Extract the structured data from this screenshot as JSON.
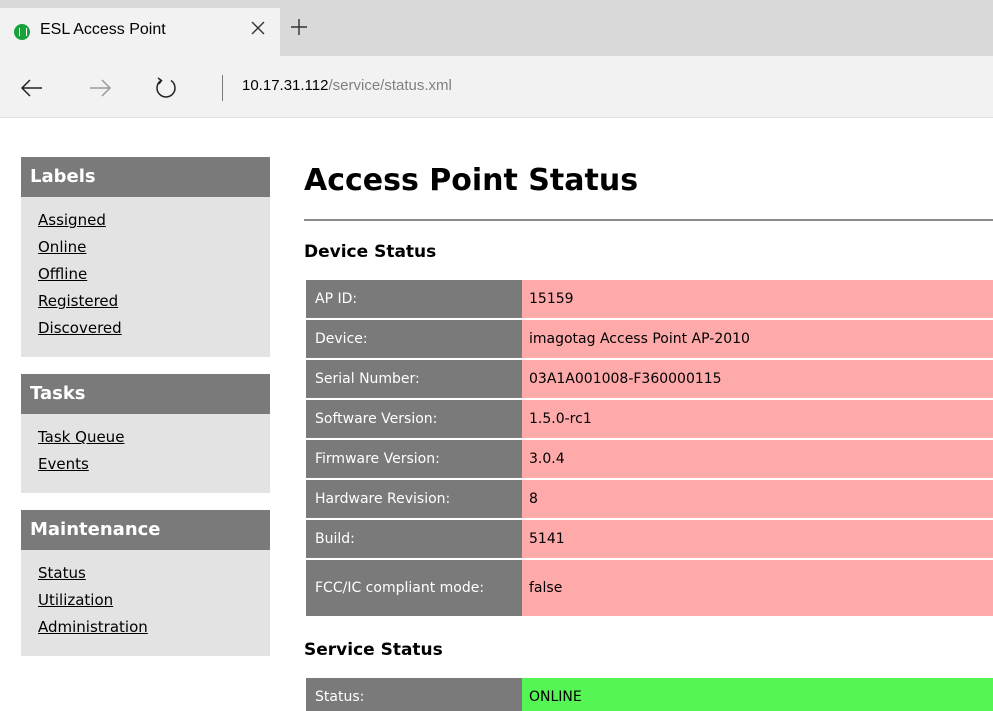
{
  "browser": {
    "tab_title": "ESL Access Point",
    "url_host": "10.17.31.112",
    "url_path": "/service/status.xml"
  },
  "sidebar": {
    "sections": [
      {
        "title": "Labels",
        "links": [
          "Assigned",
          "Online",
          "Offline",
          "Registered",
          "Discovered"
        ]
      },
      {
        "title": "Tasks",
        "links": [
          "Task Queue",
          "Events"
        ]
      },
      {
        "title": "Maintenance",
        "links": [
          "Status",
          "Utilization",
          "Administration"
        ]
      }
    ]
  },
  "main": {
    "title": "Access Point Status",
    "device_status": {
      "heading": "Device Status",
      "rows": [
        {
          "label": "AP ID:",
          "value": "15159"
        },
        {
          "label": "Device:",
          "value": "imagotag Access Point AP-2010"
        },
        {
          "label": "Serial Number:",
          "value": "03A1A001008-F360000115"
        },
        {
          "label": "Software Version:",
          "value": "1.5.0-rc1"
        },
        {
          "label": "Firmware Version:",
          "value": "3.0.4"
        },
        {
          "label": "Hardware Revision:",
          "value": "8"
        },
        {
          "label": "Build:",
          "value": "5141"
        },
        {
          "label": "FCC/IC compliant mode:",
          "value": "false"
        }
      ]
    },
    "service_status": {
      "heading": "Service Status",
      "rows": [
        {
          "label": "Status:",
          "value": "ONLINE"
        }
      ]
    }
  },
  "colors": {
    "sidebar_header": "#7a7a7a",
    "sidebar_bg": "#e3e3e3",
    "value_warning": "#ffaaaa",
    "value_ok": "#55f555"
  }
}
